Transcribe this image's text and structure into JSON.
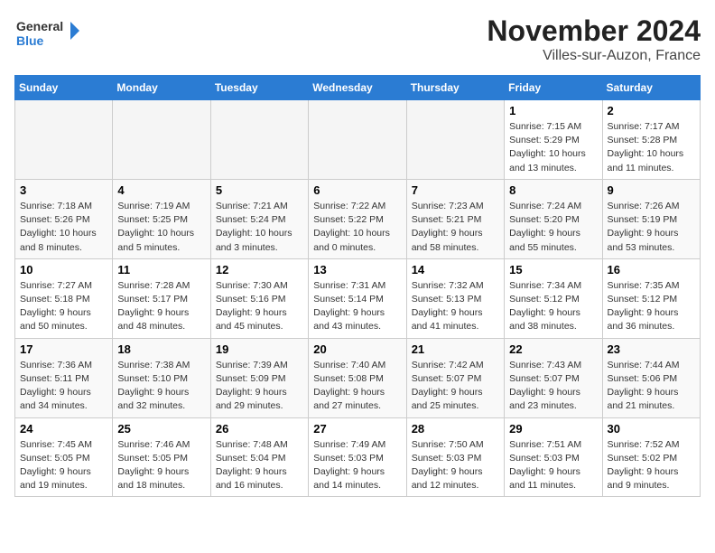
{
  "header": {
    "logo_line1": "General",
    "logo_line2": "Blue",
    "month": "November 2024",
    "location": "Villes-sur-Auzon, France"
  },
  "weekdays": [
    "Sunday",
    "Monday",
    "Tuesday",
    "Wednesday",
    "Thursday",
    "Friday",
    "Saturday"
  ],
  "weeks": [
    [
      {
        "day": "",
        "info": ""
      },
      {
        "day": "",
        "info": ""
      },
      {
        "day": "",
        "info": ""
      },
      {
        "day": "",
        "info": ""
      },
      {
        "day": "",
        "info": ""
      },
      {
        "day": "1",
        "info": "Sunrise: 7:15 AM\nSunset: 5:29 PM\nDaylight: 10 hours and 13 minutes."
      },
      {
        "day": "2",
        "info": "Sunrise: 7:17 AM\nSunset: 5:28 PM\nDaylight: 10 hours and 11 minutes."
      }
    ],
    [
      {
        "day": "3",
        "info": "Sunrise: 7:18 AM\nSunset: 5:26 PM\nDaylight: 10 hours and 8 minutes."
      },
      {
        "day": "4",
        "info": "Sunrise: 7:19 AM\nSunset: 5:25 PM\nDaylight: 10 hours and 5 minutes."
      },
      {
        "day": "5",
        "info": "Sunrise: 7:21 AM\nSunset: 5:24 PM\nDaylight: 10 hours and 3 minutes."
      },
      {
        "day": "6",
        "info": "Sunrise: 7:22 AM\nSunset: 5:22 PM\nDaylight: 10 hours and 0 minutes."
      },
      {
        "day": "7",
        "info": "Sunrise: 7:23 AM\nSunset: 5:21 PM\nDaylight: 9 hours and 58 minutes."
      },
      {
        "day": "8",
        "info": "Sunrise: 7:24 AM\nSunset: 5:20 PM\nDaylight: 9 hours and 55 minutes."
      },
      {
        "day": "9",
        "info": "Sunrise: 7:26 AM\nSunset: 5:19 PM\nDaylight: 9 hours and 53 minutes."
      }
    ],
    [
      {
        "day": "10",
        "info": "Sunrise: 7:27 AM\nSunset: 5:18 PM\nDaylight: 9 hours and 50 minutes."
      },
      {
        "day": "11",
        "info": "Sunrise: 7:28 AM\nSunset: 5:17 PM\nDaylight: 9 hours and 48 minutes."
      },
      {
        "day": "12",
        "info": "Sunrise: 7:30 AM\nSunset: 5:16 PM\nDaylight: 9 hours and 45 minutes."
      },
      {
        "day": "13",
        "info": "Sunrise: 7:31 AM\nSunset: 5:14 PM\nDaylight: 9 hours and 43 minutes."
      },
      {
        "day": "14",
        "info": "Sunrise: 7:32 AM\nSunset: 5:13 PM\nDaylight: 9 hours and 41 minutes."
      },
      {
        "day": "15",
        "info": "Sunrise: 7:34 AM\nSunset: 5:12 PM\nDaylight: 9 hours and 38 minutes."
      },
      {
        "day": "16",
        "info": "Sunrise: 7:35 AM\nSunset: 5:12 PM\nDaylight: 9 hours and 36 minutes."
      }
    ],
    [
      {
        "day": "17",
        "info": "Sunrise: 7:36 AM\nSunset: 5:11 PM\nDaylight: 9 hours and 34 minutes."
      },
      {
        "day": "18",
        "info": "Sunrise: 7:38 AM\nSunset: 5:10 PM\nDaylight: 9 hours and 32 minutes."
      },
      {
        "day": "19",
        "info": "Sunrise: 7:39 AM\nSunset: 5:09 PM\nDaylight: 9 hours and 29 minutes."
      },
      {
        "day": "20",
        "info": "Sunrise: 7:40 AM\nSunset: 5:08 PM\nDaylight: 9 hours and 27 minutes."
      },
      {
        "day": "21",
        "info": "Sunrise: 7:42 AM\nSunset: 5:07 PM\nDaylight: 9 hours and 25 minutes."
      },
      {
        "day": "22",
        "info": "Sunrise: 7:43 AM\nSunset: 5:07 PM\nDaylight: 9 hours and 23 minutes."
      },
      {
        "day": "23",
        "info": "Sunrise: 7:44 AM\nSunset: 5:06 PM\nDaylight: 9 hours and 21 minutes."
      }
    ],
    [
      {
        "day": "24",
        "info": "Sunrise: 7:45 AM\nSunset: 5:05 PM\nDaylight: 9 hours and 19 minutes."
      },
      {
        "day": "25",
        "info": "Sunrise: 7:46 AM\nSunset: 5:05 PM\nDaylight: 9 hours and 18 minutes."
      },
      {
        "day": "26",
        "info": "Sunrise: 7:48 AM\nSunset: 5:04 PM\nDaylight: 9 hours and 16 minutes."
      },
      {
        "day": "27",
        "info": "Sunrise: 7:49 AM\nSunset: 5:03 PM\nDaylight: 9 hours and 14 minutes."
      },
      {
        "day": "28",
        "info": "Sunrise: 7:50 AM\nSunset: 5:03 PM\nDaylight: 9 hours and 12 minutes."
      },
      {
        "day": "29",
        "info": "Sunrise: 7:51 AM\nSunset: 5:03 PM\nDaylight: 9 hours and 11 minutes."
      },
      {
        "day": "30",
        "info": "Sunrise: 7:52 AM\nSunset: 5:02 PM\nDaylight: 9 hours and 9 minutes."
      }
    ]
  ]
}
